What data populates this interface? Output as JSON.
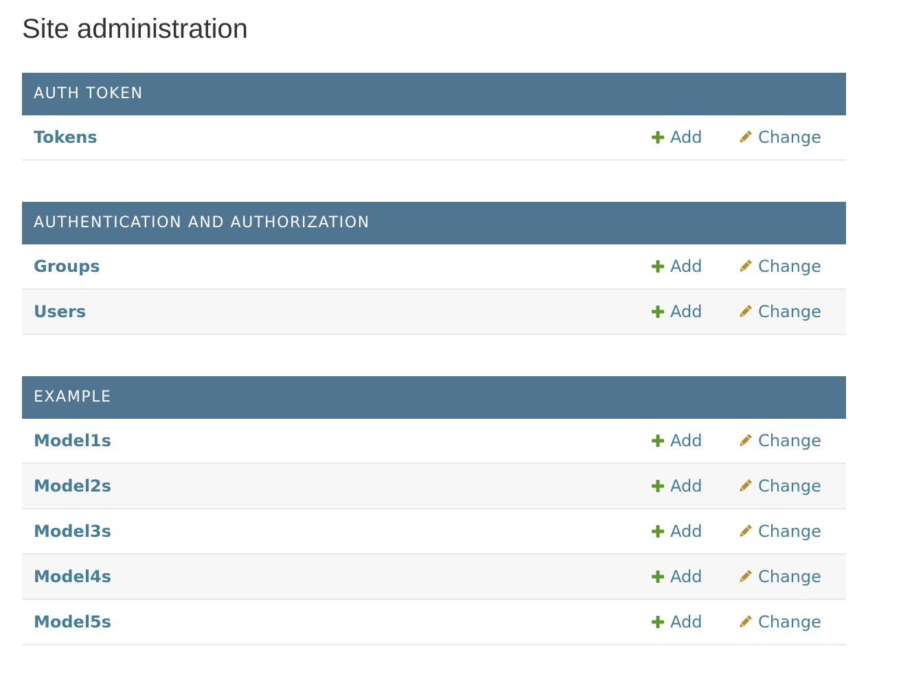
{
  "page": {
    "title": "Site administration"
  },
  "colors": {
    "caption_bg": "#4f7590",
    "link": "#447e9b",
    "add_icon": "#5b9a2b",
    "change_icon": "#b39132",
    "row_alt": "#f7f7f7",
    "divider": "#e8e8e8"
  },
  "actions": {
    "add_label": "Add",
    "change_label": "Change",
    "add_icon": "plus-icon",
    "change_icon": "pencil-icon"
  },
  "modules": [
    {
      "caption": "AUTH TOKEN",
      "models": [
        {
          "name": "Tokens"
        }
      ]
    },
    {
      "caption": "AUTHENTICATION AND AUTHORIZATION",
      "models": [
        {
          "name": "Groups"
        },
        {
          "name": "Users"
        }
      ]
    },
    {
      "caption": "EXAMPLE",
      "models": [
        {
          "name": "Model1s"
        },
        {
          "name": "Model2s"
        },
        {
          "name": "Model3s"
        },
        {
          "name": "Model4s"
        },
        {
          "name": "Model5s"
        }
      ]
    }
  ]
}
